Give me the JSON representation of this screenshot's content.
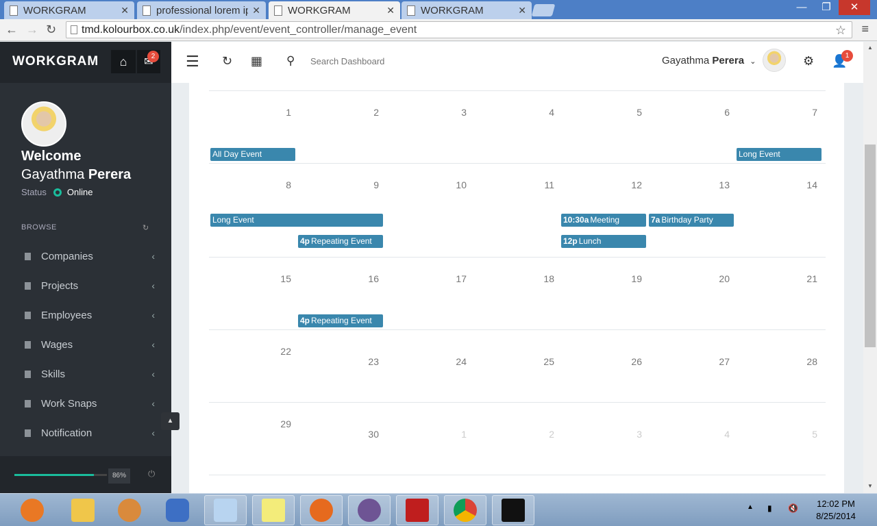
{
  "browser": {
    "tabs": [
      {
        "label": "WORKGRAM",
        "active": false
      },
      {
        "label": "professional lorem ip",
        "active": false
      },
      {
        "label": "WORKGRAM",
        "active": true
      },
      {
        "label": "WORKGRAM",
        "active": false
      }
    ],
    "url_host": "tmd.kolourbox.co.uk",
    "url_path": "/index.php/event/event_controller/manage_event"
  },
  "sidebar": {
    "brand": "WORKGRAM",
    "mail_badge": "2",
    "welcome": "Welcome",
    "user_first": "Gayathma",
    "user_last": "Perera",
    "status_label": "Status",
    "status_value": "Online",
    "section_label": "BROWSE",
    "items": [
      {
        "label": "Companies"
      },
      {
        "label": "Projects"
      },
      {
        "label": "Employees"
      },
      {
        "label": "Wages"
      },
      {
        "label": "Skills"
      },
      {
        "label": "Work Snaps"
      },
      {
        "label": "Notification"
      }
    ],
    "progress": 0.86,
    "progress_label": "86%"
  },
  "header": {
    "search_placeholder": "Search Dashboard",
    "user_first": "Gayathma",
    "user_last": "Perera",
    "notif_badge": "1"
  },
  "calendar": {
    "weeks": [
      [
        {
          "d": "1"
        },
        {
          "d": "2"
        },
        {
          "d": "3"
        },
        {
          "d": "4"
        },
        {
          "d": "5"
        },
        {
          "d": "6"
        },
        {
          "d": "7"
        }
      ],
      [
        {
          "d": "8"
        },
        {
          "d": "9"
        },
        {
          "d": "10"
        },
        {
          "d": "11"
        },
        {
          "d": "12"
        },
        {
          "d": "13"
        },
        {
          "d": "14"
        }
      ],
      [
        {
          "d": "15"
        },
        {
          "d": "16"
        },
        {
          "d": "17"
        },
        {
          "d": "18"
        },
        {
          "d": "19"
        },
        {
          "d": "20"
        },
        {
          "d": "21"
        }
      ],
      [
        {
          "d": "22"
        },
        {
          "d": "23"
        },
        {
          "d": "24"
        },
        {
          "d": "25"
        },
        {
          "d": "26"
        },
        {
          "d": "27"
        },
        {
          "d": "28"
        }
      ],
      [
        {
          "d": "29"
        },
        {
          "d": "30"
        },
        {
          "d": "1",
          "other": true
        },
        {
          "d": "2",
          "other": true
        },
        {
          "d": "3",
          "other": true
        },
        {
          "d": "4",
          "other": true
        },
        {
          "d": "5",
          "other": true
        }
      ]
    ],
    "events": [
      {
        "title": "All Day Event",
        "time": "",
        "week": 0,
        "col_start": 0,
        "span": 1,
        "slot": 0
      },
      {
        "title": "Long Event",
        "time": "",
        "week": 0,
        "col_start": 6,
        "span": 1,
        "slot": 0
      },
      {
        "title": "Long Event",
        "time": "",
        "week": 1,
        "col_start": 0,
        "span": 2,
        "slot": 0
      },
      {
        "title": "Repeating Event",
        "time": "4p",
        "week": 1,
        "col_start": 1,
        "span": 1,
        "slot": 1
      },
      {
        "title": "Meeting",
        "time": "10:30a",
        "week": 1,
        "col_start": 4,
        "span": 1,
        "slot": 0
      },
      {
        "title": "Birthday Party",
        "time": "7a",
        "week": 1,
        "col_start": 5,
        "span": 1,
        "slot": 0
      },
      {
        "title": "Lunch",
        "time": "12p",
        "week": 1,
        "col_start": 4,
        "span": 1,
        "slot": 1
      },
      {
        "title": "Repeating Event",
        "time": "4p",
        "week": 2,
        "col_start": 1,
        "span": 1,
        "slot": 0
      }
    ]
  },
  "taskbar": {
    "time": "12:02 PM",
    "date": "8/25/2014"
  }
}
